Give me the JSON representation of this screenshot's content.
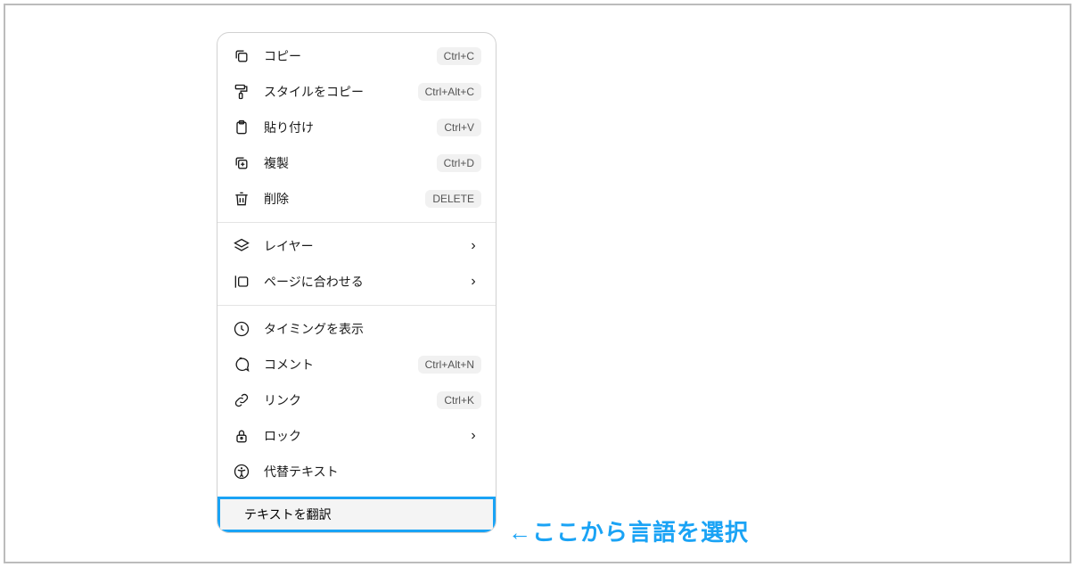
{
  "menu": {
    "sections": [
      {
        "items": [
          {
            "icon": "copy-icon",
            "label": "コピー",
            "shortcut": "Ctrl+C"
          },
          {
            "icon": "paint-roller-icon",
            "label": "スタイルをコピー",
            "shortcut": "Ctrl+Alt+C"
          },
          {
            "icon": "clipboard-icon",
            "label": "貼り付け",
            "shortcut": "Ctrl+V"
          },
          {
            "icon": "duplicate-icon",
            "label": "複製",
            "shortcut": "Ctrl+D"
          },
          {
            "icon": "trash-icon",
            "label": "削除",
            "shortcut": "DELETE"
          }
        ]
      },
      {
        "items": [
          {
            "icon": "layers-icon",
            "label": "レイヤー",
            "submenu": true
          },
          {
            "icon": "fit-page-icon",
            "label": "ページに合わせる",
            "submenu": true
          }
        ]
      },
      {
        "items": [
          {
            "icon": "clock-icon",
            "label": "タイミングを表示"
          },
          {
            "icon": "comment-icon",
            "label": "コメント",
            "shortcut": "Ctrl+Alt+N"
          },
          {
            "icon": "link-icon",
            "label": "リンク",
            "shortcut": "Ctrl+K"
          },
          {
            "icon": "lock-icon",
            "label": "ロック",
            "submenu": true
          },
          {
            "icon": "accessibility-icon",
            "label": "代替テキスト"
          }
        ]
      }
    ],
    "highlight": {
      "icon": "translate-icon",
      "label": "テキストを翻訳"
    }
  },
  "annotation": "←ここから言語を選択"
}
